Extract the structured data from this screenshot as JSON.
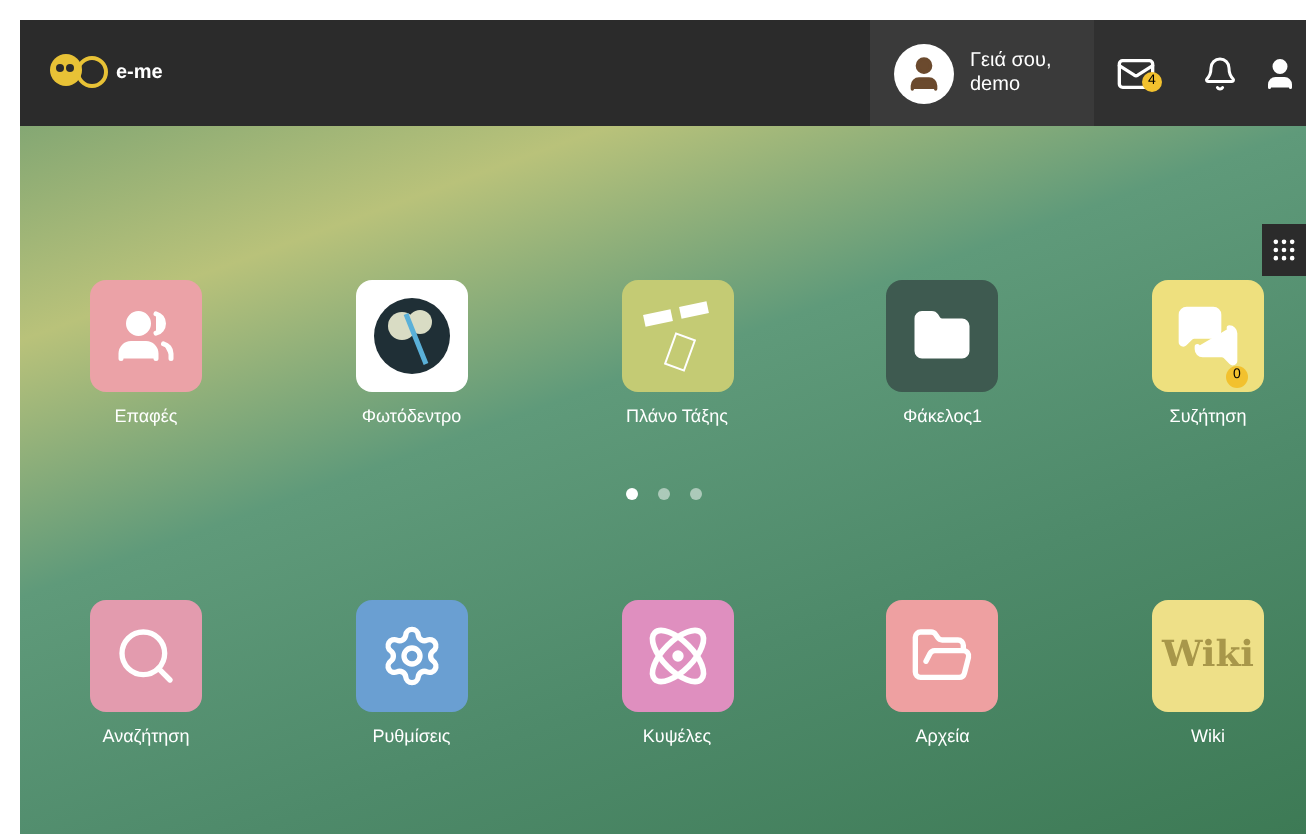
{
  "header": {
    "logo_text": "e-me",
    "greeting": "Γειά σου,",
    "username": "demo",
    "mail_badge": "4"
  },
  "rows": [
    {
      "apps": [
        {
          "kind": "contacts",
          "label": "Επαφές",
          "color": "#eba2a7"
        },
        {
          "kind": "phototree",
          "label": "Φωτόδεντρο",
          "color": "#ffffff"
        },
        {
          "kind": "plan",
          "label": "Πλάνο Τάξης",
          "color": "#c4cb74"
        },
        {
          "kind": "folder",
          "label": "Φάκελος1",
          "color": "#3e5a50"
        },
        {
          "kind": "chat",
          "label": "Συζήτηση",
          "color": "#eee07e",
          "badge": "0"
        }
      ]
    },
    {
      "apps": [
        {
          "kind": "search",
          "label": "Αναζήτηση",
          "color": "#e39bae"
        },
        {
          "kind": "settings",
          "label": "Ρυθμίσεις",
          "color": "#6a9fd2"
        },
        {
          "kind": "atom",
          "label": "Κυψέλες",
          "color": "#df8fbf"
        },
        {
          "kind": "files",
          "label": "Αρχεία",
          "color": "#eea0a1"
        },
        {
          "kind": "wiki",
          "label": "Wiki",
          "color": "#eee088",
          "icon_text": "Wiki"
        }
      ]
    }
  ],
  "pages": [
    {
      "selected": true
    },
    {
      "selected": false
    },
    {
      "selected": false
    }
  ]
}
